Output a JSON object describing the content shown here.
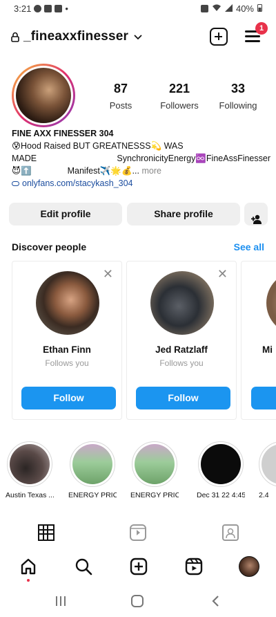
{
  "status_bar": {
    "time": "3:21",
    "battery": "40%"
  },
  "header": {
    "username": "_fineaxxfinesser",
    "notification_count": "1"
  },
  "profile": {
    "stats": [
      {
        "value": "87",
        "label": "Posts"
      },
      {
        "value": "221",
        "label": "Followers"
      },
      {
        "value": "33",
        "label": "Following"
      }
    ],
    "bio": {
      "name": "FINE AXX FINESSER 304",
      "line1": "😰Hood Raised BUT GREATNESSS💫 WAS",
      "line2_left": "MADE",
      "line2_right": "SynchronicityEnergy♾️FineAssFinesser",
      "line3_left": "😈⬆️",
      "line3_right": "Manifest✈️🌟💰...",
      "more": "more",
      "link": "onlyfans.com/stacykash_304"
    },
    "buttons": {
      "edit": "Edit profile",
      "share": "Share profile"
    }
  },
  "discover": {
    "title": "Discover people",
    "see_all": "See all",
    "cards": [
      {
        "name": "Ethan Finn",
        "subtitle": "Follows you",
        "button": "Follow"
      },
      {
        "name": "Jed Ratzlaff",
        "subtitle": "Follows you",
        "button": "Follow"
      },
      {
        "name": "Mi"
      }
    ]
  },
  "highlights": [
    {
      "caption": "Austin Texas ..."
    },
    {
      "caption": "ENERGY PRIC..."
    },
    {
      "caption": "ENERGY PRIC..."
    },
    {
      "caption": "Dec 31 22 4:45"
    },
    {
      "caption": "2.4"
    }
  ],
  "colors": {
    "accent": "#1b95f0",
    "see_all": "#1b8ff0",
    "badge": "#e8324a",
    "link": "#1a4c9e"
  },
  "icons": [
    "lock-icon",
    "chevron-down-icon",
    "create-plus-icon",
    "menu-icon",
    "add-person-icon",
    "close-icon",
    "grid-icon",
    "reels-icon",
    "tagged-icon",
    "home-icon",
    "search-icon",
    "profile-avatar"
  ]
}
